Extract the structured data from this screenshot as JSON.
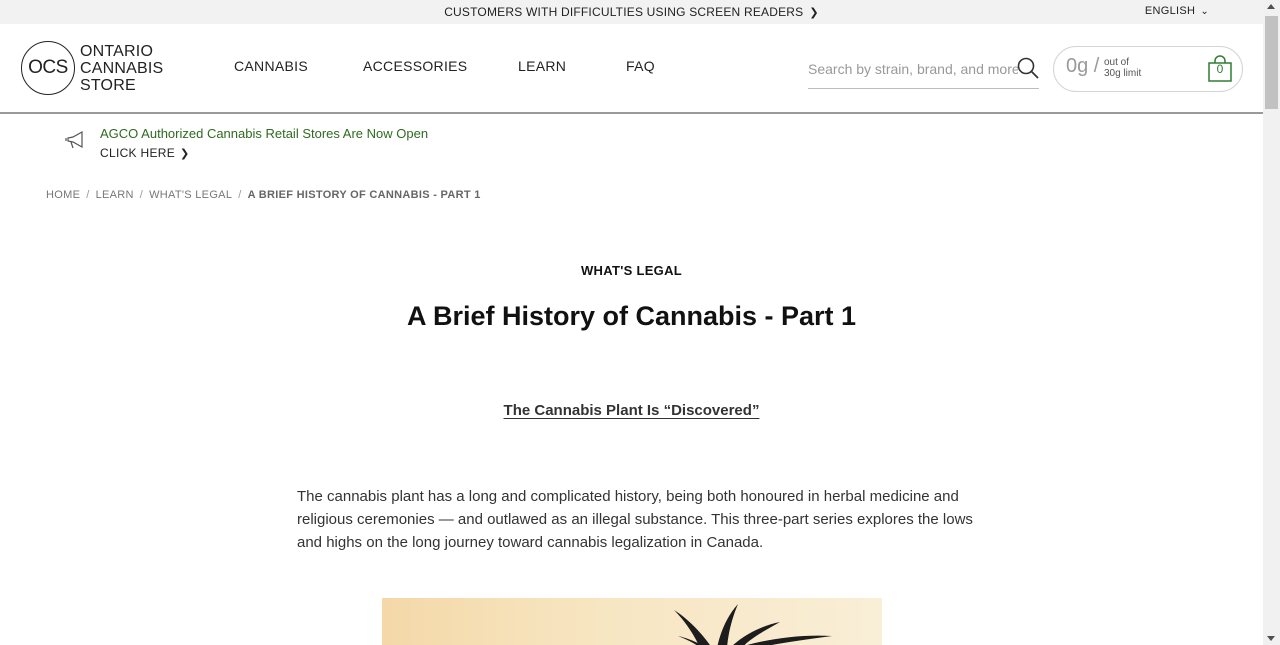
{
  "topbar": {
    "screen_reader_text": "CUSTOMERS WITH DIFFICULTIES USING SCREEN READERS",
    "language": "ENGLISH"
  },
  "logo": {
    "mark": "OCS",
    "line1": "ONTARIO",
    "line2": "CANNABIS",
    "line3": "STORE"
  },
  "nav": {
    "items": [
      {
        "label": "CANNABIS"
      },
      {
        "label": "ACCESSORIES"
      },
      {
        "label": "LEARN"
      },
      {
        "label": "FAQ"
      }
    ]
  },
  "search": {
    "placeholder": "Search by strain, brand, and more"
  },
  "cart": {
    "grams": "0g /",
    "limit_line1": "out of",
    "limit_line2": "30g limit",
    "count": "0",
    "accent_color": "#2e7d32"
  },
  "announcement": {
    "message": "AGCO Authorized Cannabis Retail Stores Are Now Open",
    "cta": "CLICK HERE"
  },
  "breadcrumb": {
    "items": [
      "HOME",
      "LEARN",
      "WHAT'S LEGAL"
    ],
    "current": "A BRIEF HISTORY OF CANNABIS - PART 1"
  },
  "article": {
    "category": "WHAT'S LEGAL",
    "title": "A Brief History of Cannabis - Part 1",
    "subheading": "The Cannabis Plant Is “Discovered”",
    "intro": "The cannabis plant has a long and complicated history, being both honoured in herbal medicine and religious ceremonies — and outlawed as an illegal substance. This three-part series explores the lows and highs on the long journey toward cannabis legalization in Canada."
  }
}
